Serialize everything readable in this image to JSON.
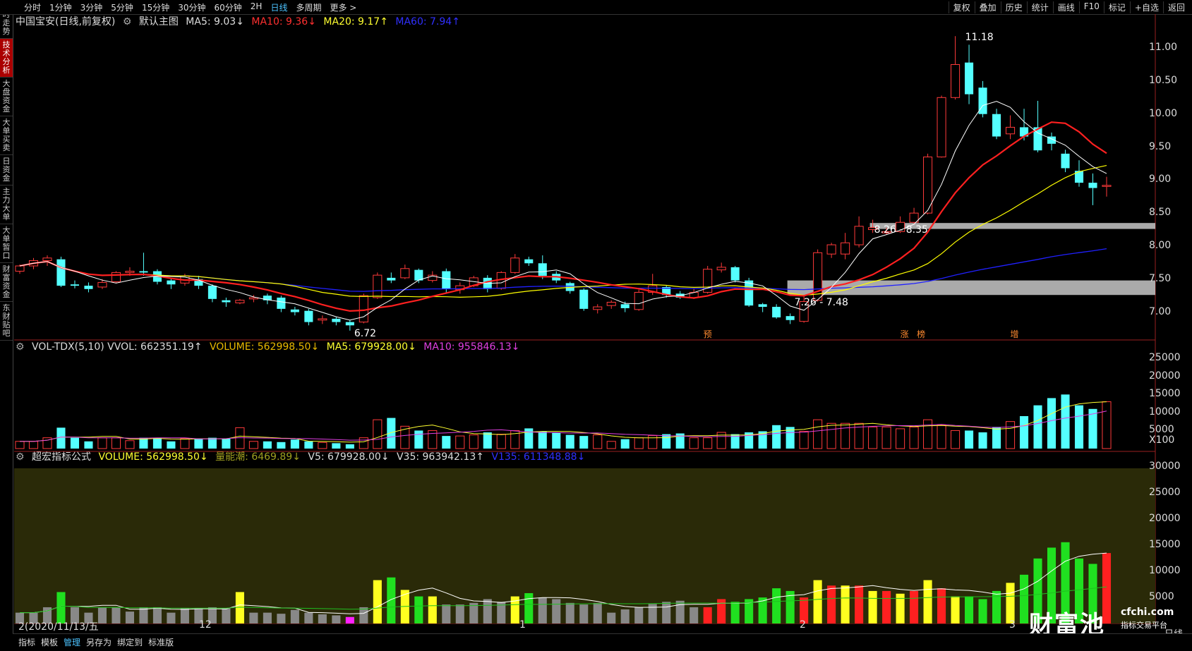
{
  "top_tabs": [
    "分时",
    "1分钟",
    "3分钟",
    "5分钟",
    "15分钟",
    "30分钟",
    "60分钟",
    "2H",
    "日线",
    "多周期",
    "更多 >"
  ],
  "top_active": "日线",
  "top_right": [
    "复权",
    "叠加",
    "历史",
    "统计",
    "画线",
    "F10",
    "标记",
    "+自选",
    "返回"
  ],
  "left_nav": [
    "分时走势",
    "技术分析",
    "大盘资金",
    "大单买卖",
    "日资金",
    "主力大单",
    "大单暂口",
    "财富资金",
    "东财贴吧"
  ],
  "left_active": "技术分析",
  "main_header": {
    "name": "中国宝安(日线,前复权)",
    "template": "默认主图",
    "ma5": "MA5: 9.03↓",
    "ma10": "MA10: 9.36↓",
    "ma20": "MA20: 9.17↑",
    "ma60": "MA60: 7.94↑"
  },
  "vol_header": {
    "label": "VOL-TDX(5,10) VVOL: 662351.19↑",
    "volume": "VOLUME: 562998.50↓",
    "ma5": "MA5: 679928.00↓",
    "ma10": "MA10: 955846.13↓"
  },
  "ind_header": {
    "label": "超宏指标公式",
    "volume": "VOLUME: 562998.50↓",
    "tide": "量能潮: 6469.89↓",
    "v5": "V5: 679928.00↓",
    "v35": "V35: 963942.13↑",
    "v135": "V135: 611348.88↓"
  },
  "price_axis": [
    "11.00",
    "10.50",
    "10.00",
    "9.50",
    "9.00",
    "8.50",
    "8.00",
    "7.50",
    "7.00"
  ],
  "vol_axis": [
    "25000",
    "20000",
    "15000",
    "10000",
    "5000",
    "X100"
  ],
  "ind_axis": [
    "30000",
    "25000",
    "20000",
    "15000",
    "10000",
    "5000"
  ],
  "date_labels": [
    "2(2020/11/13/五",
    "12",
    "1",
    "2",
    "3"
  ],
  "annotations": {
    "high": "11.18",
    "low": "6.72",
    "zone_low": "7.26 - 7.48",
    "zone_high": "8.26 - 8.35",
    "tag1": "预",
    "tag2": "涨",
    "tag3": "榜",
    "tag4": "增"
  },
  "bottom_tabs": [
    "指标",
    "模板",
    "管理",
    "另存为",
    "绑定到",
    "标准版"
  ],
  "bottom_active": "管理",
  "watermark": {
    "brand": "财富池",
    "url": "cfchi.com",
    "sub": "指标交易平台"
  },
  "corner_label": "日线",
  "colors": {
    "up": "#ff3a3a",
    "down": "#54ffff",
    "ma5": "#ffffff",
    "ma10": "#ff2020",
    "ma20": "#ffff00",
    "ma60": "#2020ff",
    "zone": "#c8c8c8",
    "ind_bg": "#2a2a08"
  },
  "chart_data": {
    "type": "candlestick",
    "price_range": [
      6.6,
      11.3
    ],
    "candles": [
      [
        7.62,
        7.7,
        7.58,
        7.72
      ],
      [
        7.7,
        7.78,
        7.65,
        7.82
      ],
      [
        7.78,
        7.82,
        7.7,
        7.86
      ],
      [
        7.8,
        7.4,
        7.38,
        7.84
      ],
      [
        7.42,
        7.4,
        7.36,
        7.48
      ],
      [
        7.4,
        7.35,
        7.3,
        7.45
      ],
      [
        7.38,
        7.45,
        7.35,
        7.5
      ],
      [
        7.46,
        7.6,
        7.44,
        7.62
      ],
      [
        7.6,
        7.62,
        7.55,
        7.68
      ],
      [
        7.62,
        7.6,
        7.55,
        7.9
      ],
      [
        7.62,
        7.46,
        7.42,
        7.65
      ],
      [
        7.48,
        7.42,
        7.35,
        7.52
      ],
      [
        7.44,
        7.55,
        7.4,
        7.58
      ],
      [
        7.5,
        7.4,
        7.35,
        7.55
      ],
      [
        7.4,
        7.2,
        7.15,
        7.42
      ],
      [
        7.18,
        7.15,
        7.08,
        7.22
      ],
      [
        7.14,
        7.18,
        7.12,
        7.2
      ],
      [
        7.2,
        7.22,
        7.15,
        7.26
      ],
      [
        7.25,
        7.18,
        7.12,
        7.28
      ],
      [
        7.22,
        7.05,
        7.0,
        7.25
      ],
      [
        7.04,
        7.0,
        6.95,
        7.08
      ],
      [
        7.02,
        6.85,
        6.8,
        7.05
      ],
      [
        6.88,
        6.9,
        6.82,
        6.95
      ],
      [
        6.9,
        6.85,
        6.8,
        6.93
      ],
      [
        6.85,
        6.8,
        6.72,
        6.88
      ],
      [
        6.85,
        7.25,
        6.83,
        7.28
      ],
      [
        7.22,
        7.56,
        7.2,
        7.6
      ],
      [
        7.52,
        7.48,
        7.44,
        7.6
      ],
      [
        7.52,
        7.66,
        7.5,
        7.72
      ],
      [
        7.64,
        7.48,
        7.44,
        7.66
      ],
      [
        7.48,
        7.56,
        7.45,
        7.62
      ],
      [
        7.62,
        7.35,
        7.3,
        7.66
      ],
      [
        7.34,
        7.4,
        7.28,
        7.45
      ],
      [
        7.4,
        7.52,
        7.38,
        7.55
      ],
      [
        7.52,
        7.35,
        7.3,
        7.56
      ],
      [
        7.36,
        7.6,
        7.34,
        7.62
      ],
      [
        7.6,
        7.82,
        7.58,
        7.88
      ],
      [
        7.8,
        7.74,
        7.7,
        7.84
      ],
      [
        7.74,
        7.55,
        7.5,
        7.86
      ],
      [
        7.58,
        7.48,
        7.44,
        7.62
      ],
      [
        7.44,
        7.32,
        7.28,
        7.46
      ],
      [
        7.34,
        7.05,
        7.02,
        7.36
      ],
      [
        7.04,
        7.08,
        6.98,
        7.12
      ],
      [
        7.1,
        7.15,
        7.05,
        7.18
      ],
      [
        7.12,
        7.06,
        7.0,
        7.16
      ],
      [
        7.04,
        7.3,
        7.02,
        7.34
      ],
      [
        7.3,
        7.4,
        7.26,
        7.58
      ],
      [
        7.38,
        7.26,
        7.22,
        7.4
      ],
      [
        7.28,
        7.22,
        7.2,
        7.32
      ],
      [
        7.22,
        7.3,
        7.2,
        7.36
      ],
      [
        7.3,
        7.65,
        7.28,
        7.7
      ],
      [
        7.64,
        7.68,
        7.6,
        7.75
      ],
      [
        7.68,
        7.48,
        7.45,
        7.7
      ],
      [
        7.48,
        7.1,
        7.08,
        7.52
      ],
      [
        7.12,
        7.08,
        7.0,
        7.14
      ],
      [
        7.08,
        6.92,
        6.9,
        7.12
      ],
      [
        6.94,
        6.88,
        6.82,
        6.98
      ],
      [
        6.86,
        7.16,
        6.84,
        7.26
      ],
      [
        7.18,
        7.9,
        7.16,
        7.95
      ],
      [
        7.88,
        8.02,
        7.82,
        8.05
      ],
      [
        7.88,
        8.05,
        7.8,
        8.2
      ],
      [
        8.02,
        8.3,
        7.98,
        8.45
      ],
      [
        8.25,
        8.28,
        8.2,
        8.4
      ],
      [
        8.2,
        8.22,
        8.18,
        8.28
      ],
      [
        8.22,
        8.36,
        8.2,
        8.45
      ],
      [
        8.36,
        8.5,
        8.34,
        8.58
      ],
      [
        8.5,
        9.35,
        8.48,
        9.4
      ],
      [
        9.35,
        10.25,
        9.34,
        10.28
      ],
      [
        10.25,
        10.75,
        10.22,
        11.18
      ],
      [
        10.78,
        10.3,
        10.15,
        11.05
      ],
      [
        10.4,
        10.0,
        9.95,
        10.5
      ],
      [
        10.0,
        9.66,
        9.62,
        10.08
      ],
      [
        9.7,
        9.8,
        9.62,
        9.98
      ],
      [
        9.8,
        9.66,
        9.6,
        10.08
      ],
      [
        9.8,
        9.45,
        9.42,
        10.2
      ],
      [
        9.66,
        9.55,
        9.45,
        9.72
      ],
      [
        9.4,
        9.18,
        9.12,
        9.46
      ],
      [
        9.14,
        8.96,
        8.9,
        9.3
      ],
      [
        8.96,
        8.88,
        8.62,
        9.1
      ],
      [
        8.92,
        8.92,
        8.75,
        9.05
      ]
    ],
    "volume_x100": [
      2000,
      2000,
      3000,
      5800,
      3000,
      2000,
      3000,
      3000,
      2200,
      3000,
      3000,
      2000,
      2800,
      2800,
      3000,
      2800,
      5800,
      2000,
      2000,
      1800,
      2500,
      2000,
      1700,
      1500,
      1200,
      3000,
      8000,
      8500,
      6200,
      5000,
      5000,
      3500,
      3500,
      3800,
      4500,
      4000,
      5000,
      5600,
      4800,
      4500,
      3800,
      3500,
      3800,
      2000,
      2600,
      3000,
      3600,
      4000,
      4200,
      3000,
      3000,
      4500,
      4000,
      4500,
      4800,
      6500,
      6000,
      4800,
      8000,
      7000,
      7000,
      7000,
      6000,
      6000,
      5500,
      6000,
      8000,
      6500,
      5000,
      5000,
      4500,
      6000,
      7500,
      9000,
      12000,
      14000,
      15000,
      12000,
      11000,
      13000
    ]
  }
}
